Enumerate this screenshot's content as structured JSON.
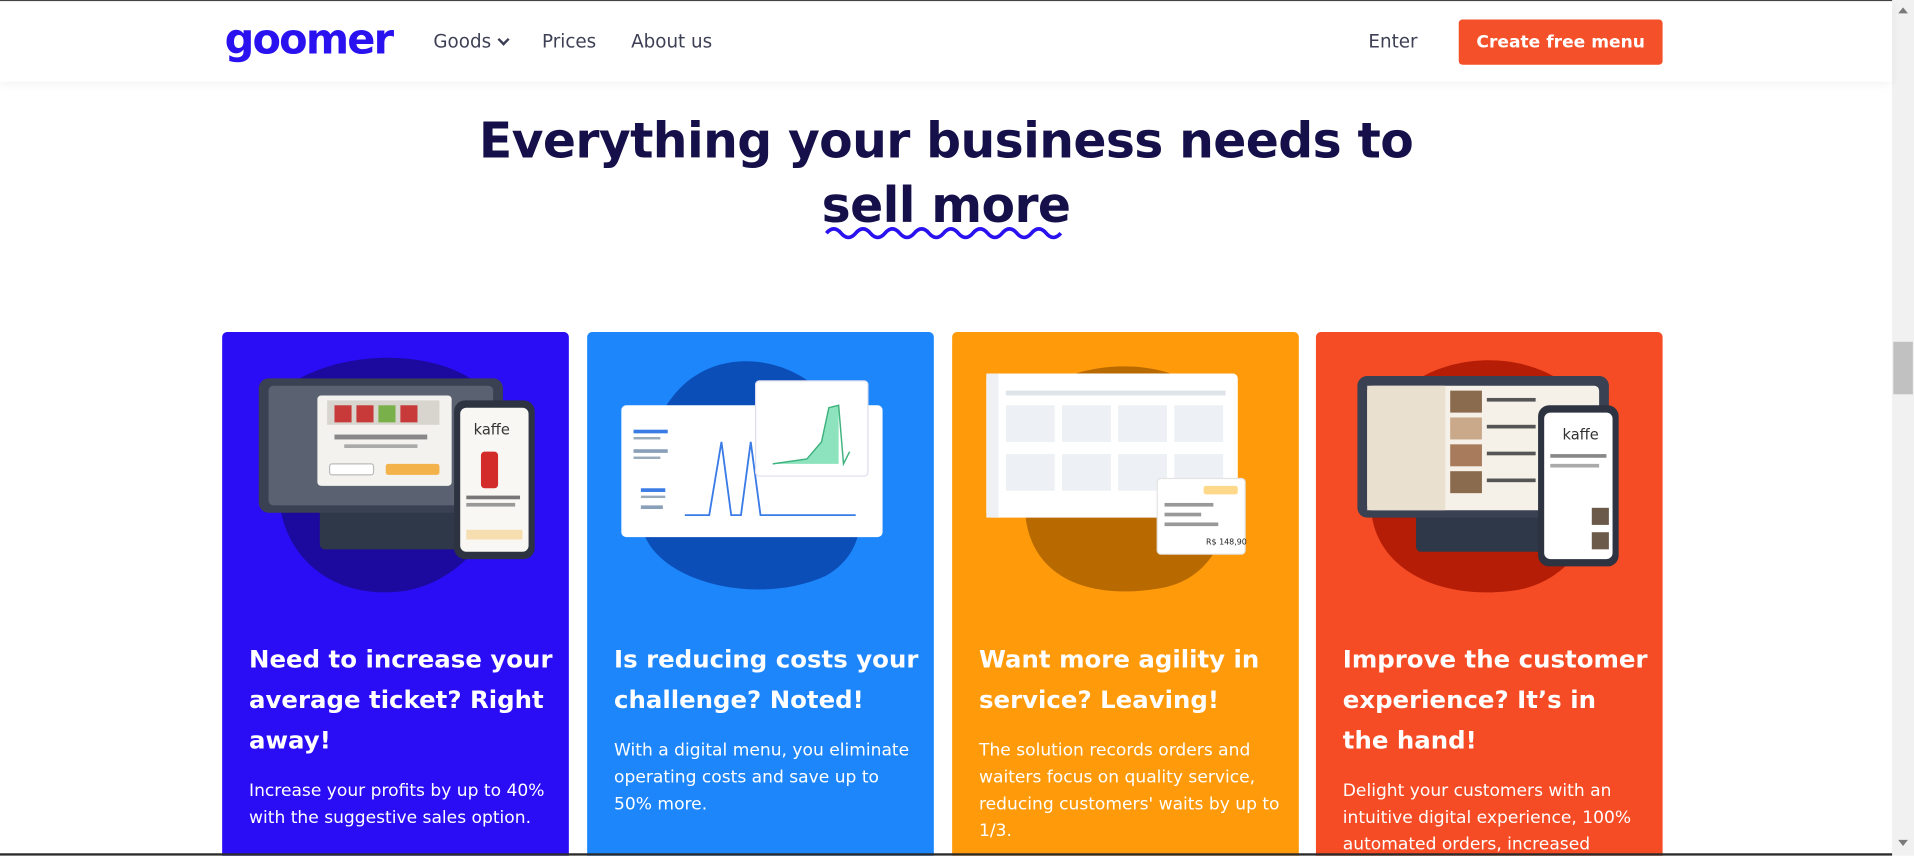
{
  "header": {
    "logo": "goomer",
    "nav": {
      "goods": "Goods",
      "prices": "Prices",
      "about": "About us",
      "enter": "Enter"
    },
    "cta": "Create free menu"
  },
  "hero": {
    "line1": "Everything your business needs to",
    "line2": "sell more"
  },
  "cards": [
    {
      "title": "Need to increase your average ticket? Right away!",
      "text": "Increase your profits by up to 40% with the suggestive sales option.",
      "color": "#2a0cf5"
    },
    {
      "title": "Is reducing costs your challenge? Noted!",
      "text": "With a digital menu, you eliminate operating costs and save up to 50% more.",
      "color": "#1d86fb"
    },
    {
      "title": "Want more agility in service? Leaving!",
      "text": "The solution records orders and waiters focus on quality service, reducing customers' waits by up to 1/3.",
      "color": "#ff9a0a"
    },
    {
      "title": "Improve the customer experience? It’s in the hand!",
      "text": "Delight your customers with an intuitive digital experience, 100% automated orders, increased",
      "color": "#f54c25"
    }
  ],
  "mock": {
    "kaffe": "kaffe",
    "price": "R$ 148,90"
  },
  "icons": [
    "chevron-down-icon",
    "scroll-up-icon",
    "scroll-down-icon"
  ],
  "colors": {
    "brand": "#2a12f0",
    "cta": "#f4502a",
    "heading": "#15104a"
  }
}
